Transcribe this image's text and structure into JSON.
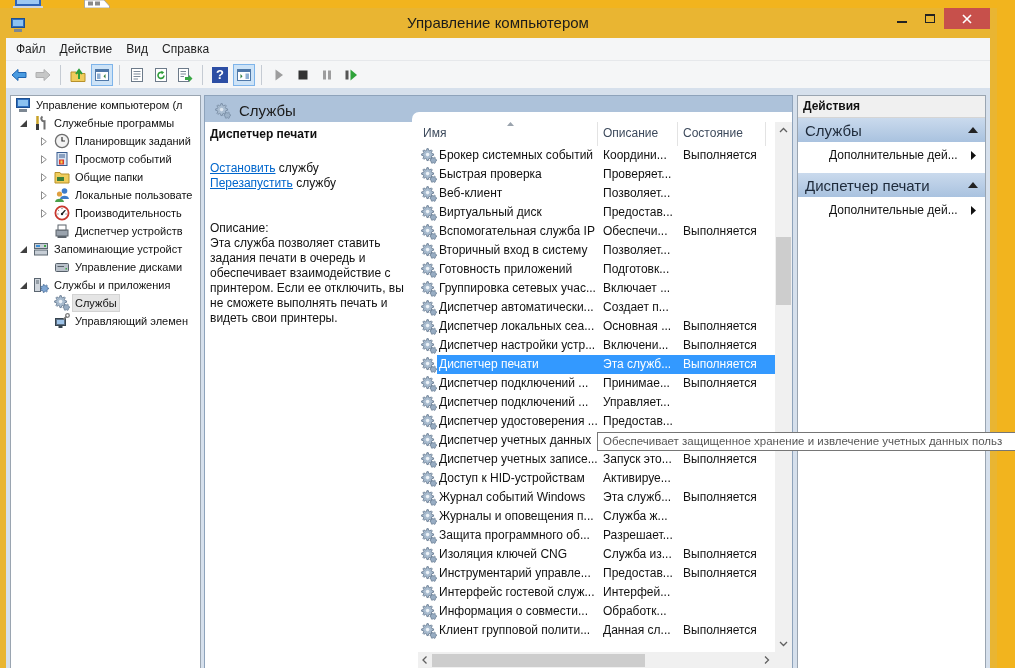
{
  "window": {
    "title": "Управление компьютером"
  },
  "menu": [
    "Файл",
    "Действие",
    "Вид",
    "Справка"
  ],
  "toolbar": {
    "groups": [
      [
        {
          "disabled": false,
          "pressed": false
        },
        {
          "disabled": true,
          "pressed": false
        }
      ],
      [
        {
          "disabled": false,
          "pressed": false
        },
        {
          "disabled": false,
          "pressed": true
        }
      ],
      [
        {
          "disabled": false,
          "pressed": false
        },
        {
          "disabled": false,
          "pressed": false
        },
        {
          "disabled": false,
          "pressed": false
        }
      ],
      [
        {
          "label": "?",
          "disabled": false,
          "pressed": false
        },
        {
          "disabled": false,
          "pressed": true
        }
      ],
      [
        {
          "disabled": true,
          "pressed": false
        },
        {
          "disabled": false,
          "pressed": false
        },
        {
          "disabled": true,
          "pressed": false
        },
        {
          "disabled": false,
          "pressed": false
        }
      ]
    ]
  },
  "tree": {
    "items": [
      {
        "label": "Управление компьютером (л",
        "selected": false,
        "children": [
          {
            "label": "Служебные программы",
            "expanded": true,
            "selected": false,
            "children": [
              {
                "label": "Планировщик заданий",
                "expanded": false,
                "selected": false
              },
              {
                "label": "Просмотр событий",
                "expanded": false,
                "selected": false
              },
              {
                "label": "Общие папки",
                "expanded": false,
                "selected": false
              },
              {
                "label": "Локальные пользовате",
                "expanded": false,
                "selected": false
              },
              {
                "label": "Производительность",
                "expanded": false,
                "selected": false
              },
              {
                "label": "Диспетчер устройств",
                "selected": false
              }
            ]
          },
          {
            "label": "Запоминающие устройст",
            "expanded": true,
            "selected": false,
            "children": [
              {
                "label": "Управление дисками",
                "selected": false
              }
            ]
          },
          {
            "label": "Службы и приложения",
            "expanded": true,
            "selected": false,
            "children": [
              {
                "label": "Службы",
                "selected": true
              },
              {
                "label": "Управляющий элемен",
                "selected": false
              }
            ]
          }
        ]
      }
    ]
  },
  "services": {
    "title": "Службы",
    "details": {
      "title": "Диспетчер печати",
      "actions": [
        {
          "link": "Остановить",
          "text": "службу"
        },
        {
          "link": "Перезапустить",
          "text": "службу"
        }
      ],
      "description_label": "Описание:",
      "description": "Эта служба позволяет ставить задания печати в очередь и обеспечивает взаимодействие с принтером. Если ее отключить, вы не сможете выполнять печать и видеть свои принтеры."
    },
    "table": {
      "columns": [
        {
          "label": "Имя",
          "sorted": true
        },
        {
          "label": "Описание",
          "sorted": false
        },
        {
          "label": "Состояние",
          "sorted": false
        }
      ],
      "rows": [
        {
          "name": "Брокер системных событий",
          "description": "Координи...",
          "status": "Выполняется",
          "selected": false
        },
        {
          "name": "Быстрая проверка",
          "description": "Проверяет...",
          "selected": false
        },
        {
          "name": "Веб-клиент",
          "description": "Позволяет...",
          "selected": false
        },
        {
          "name": "Виртуальный диск",
          "description": "Предостав...",
          "selected": false
        },
        {
          "name": "Вспомогательная служба IP",
          "description": "Обеспечи...",
          "status": "Выполняется",
          "selected": false
        },
        {
          "name": "Вторичный вход в систему",
          "description": "Позволяет...",
          "selected": false
        },
        {
          "name": "Готовность приложений",
          "description": "Подготовк...",
          "selected": false
        },
        {
          "name": "Группировка сетевых учас...",
          "description": "Включает ...",
          "selected": false
        },
        {
          "name": "Диспетчер автоматически...",
          "description": "Создает п...",
          "selected": false
        },
        {
          "name": "Диспетчер локальных сеа...",
          "description": "Основная ...",
          "status": "Выполняется",
          "selected": false
        },
        {
          "name": "Диспетчер настройки устр...",
          "description": "Включени...",
          "status": "Выполняется",
          "selected": false
        },
        {
          "name": "Диспетчер печати",
          "description": "Эта служб...",
          "status": "Выполняется",
          "selected": true
        },
        {
          "name": "Диспетчер подключений ...",
          "description": "Принимае...",
          "status": "Выполняется",
          "selected": false
        },
        {
          "name": "Диспетчер подключений ...",
          "description": "Управляет...",
          "selected": false
        },
        {
          "name": "Диспетчер удостоверения ...",
          "description": "Предостав...",
          "selected": false
        },
        {
          "name": "Диспетчер учетных данных",
          "selected": false
        },
        {
          "name": "Диспетчер учетных записе...",
          "description": "Запуск это...",
          "status": "Выполняется",
          "selected": false
        },
        {
          "name": "Доступ к HID-устройствам",
          "description": "Активируе...",
          "selected": false
        },
        {
          "name": "Журнал событий Windows",
          "description": "Эта служб...",
          "status": "Выполняется",
          "selected": false
        },
        {
          "name": "Журналы и оповещения п...",
          "description": "Служба ж...",
          "selected": false
        },
        {
          "name": "Защита программного об...",
          "description": "Разрешает...",
          "selected": false
        },
        {
          "name": "Изоляция ключей CNG",
          "description": "Служба из...",
          "status": "Выполняется",
          "selected": false
        },
        {
          "name": "Инструментарий управле...",
          "description": "Предостав...",
          "status": "Выполняется",
          "selected": false
        },
        {
          "name": "Интерфейс гостевой служ...",
          "description": "Интерфей...",
          "selected": false
        },
        {
          "name": "Информация о совмести...",
          "description": "Обработк...",
          "selected": false
        },
        {
          "name": "Клиент групповой полити...",
          "description": "Данная сл...",
          "status": "Выполняется",
          "selected": false
        }
      ],
      "tooltip": "Обеспечивает защищенное хранение и извлечение учетных данных польз"
    }
  },
  "actions": {
    "title": "Действия",
    "sections": [
      {
        "title": "Службы",
        "expanded": true,
        "items": [
          "Дополнительные дей..."
        ]
      },
      {
        "title": "Диспетчер печати",
        "expanded": true,
        "items": [
          "Дополнительные дей..."
        ]
      }
    ]
  }
}
